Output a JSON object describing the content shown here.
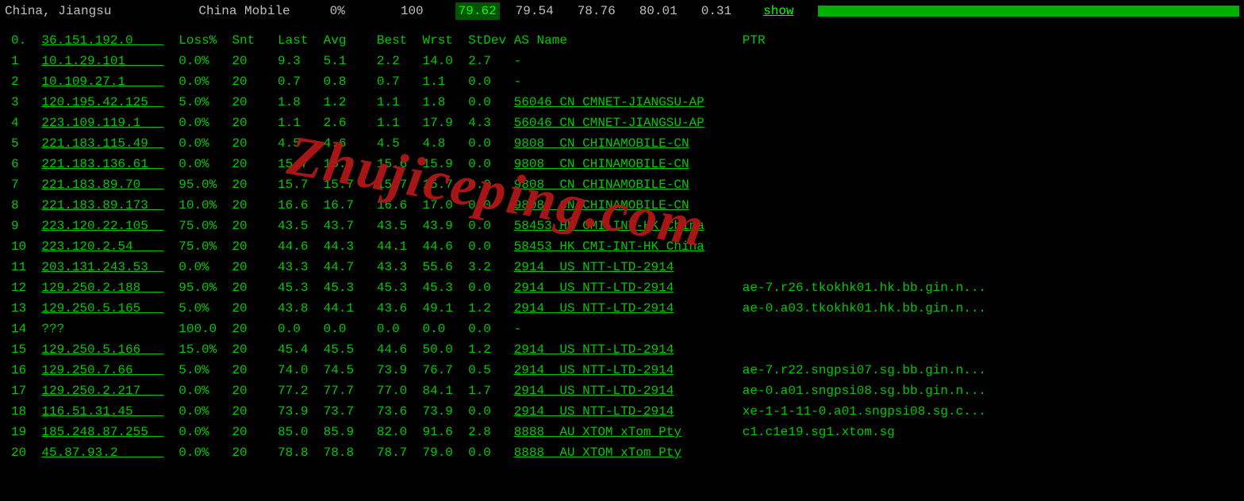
{
  "topbar": {
    "location": "China, Jiangsu",
    "isp": "China Mobile",
    "loss": "0%",
    "snt": "100",
    "v1": "79.62",
    "v2": "79.54",
    "v3": "78.76",
    "v4": "80.01",
    "v5": "0.31",
    "show": "show"
  },
  "headers": {
    "hop": "0.",
    "ip": "36.151.192.0",
    "loss": "Loss%",
    "snt": "Snt",
    "last": "Last",
    "avg": "Avg",
    "best": "Best",
    "wrst": "Wrst",
    "stdev": "StDev",
    "asname": "AS Name",
    "ptr": "PTR"
  },
  "rows": [
    {
      "n": "1",
      "ip": "10.1.29.101",
      "loss": "0.0%",
      "snt": "20",
      "last": "9.3",
      "avg": "5.1",
      "best": "2.2",
      "wrst": "14.0",
      "stdev": "2.7",
      "as": "-",
      "ptr": ""
    },
    {
      "n": "2",
      "ip": "10.109.27.1",
      "loss": "0.0%",
      "snt": "20",
      "last": "0.7",
      "avg": "0.8",
      "best": "0.7",
      "wrst": "1.1",
      "stdev": "0.0",
      "as": "-",
      "ptr": ""
    },
    {
      "n": "3",
      "ip": "120.195.42.125",
      "loss": "5.0%",
      "snt": "20",
      "last": "1.8",
      "avg": "1.2",
      "best": "1.1",
      "wrst": "1.8",
      "stdev": "0.0",
      "as": "56046 CN CMNET-JIANGSU-AP",
      "ptr": ""
    },
    {
      "n": "4",
      "ip": "223.109.119.1",
      "loss": "0.0%",
      "snt": "20",
      "last": "1.1",
      "avg": "2.6",
      "best": "1.1",
      "wrst": "17.9",
      "stdev": "4.3",
      "as": "56046 CN CMNET-JIANGSU-AP",
      "ptr": ""
    },
    {
      "n": "5",
      "ip": "221.183.115.49",
      "loss": "0.0%",
      "snt": "20",
      "last": "4.5",
      "avg": "4.6",
      "best": "4.5",
      "wrst": "4.8",
      "stdev": "0.0",
      "as": "9808  CN CHINAMOBILE-CN",
      "ptr": ""
    },
    {
      "n": "6",
      "ip": "221.183.136.61",
      "loss": "0.0%",
      "snt": "20",
      "last": "15.7",
      "avg": "15.7",
      "best": "15.6",
      "wrst": "15.9",
      "stdev": "0.0",
      "as": "9808  CN CHINAMOBILE-CN",
      "ptr": ""
    },
    {
      "n": "7",
      "ip": "221.183.89.70",
      "loss": "95.0%",
      "snt": "20",
      "last": "15.7",
      "avg": "15.7",
      "best": "15.7",
      "wrst": "15.7",
      "stdev": "0.0",
      "as": "9808  CN CHINAMOBILE-CN",
      "ptr": ""
    },
    {
      "n": "8",
      "ip": "221.183.89.173",
      "loss": "10.0%",
      "snt": "20",
      "last": "16.6",
      "avg": "16.7",
      "best": "16.6",
      "wrst": "17.0",
      "stdev": "0.0",
      "as": "9808  CN CHINAMOBILE-CN",
      "ptr": ""
    },
    {
      "n": "9",
      "ip": "223.120.22.105",
      "loss": "75.0%",
      "snt": "20",
      "last": "43.5",
      "avg": "43.7",
      "best": "43.5",
      "wrst": "43.9",
      "stdev": "0.0",
      "as": "58453 HK CMI-INT-HK China",
      "ptr": ""
    },
    {
      "n": "10",
      "ip": "223.120.2.54",
      "loss": "75.0%",
      "snt": "20",
      "last": "44.6",
      "avg": "44.3",
      "best": "44.1",
      "wrst": "44.6",
      "stdev": "0.0",
      "as": "58453 HK CMI-INT-HK China",
      "ptr": ""
    },
    {
      "n": "11",
      "ip": "203.131.243.53",
      "loss": "0.0%",
      "snt": "20",
      "last": "43.3",
      "avg": "44.7",
      "best": "43.3",
      "wrst": "55.6",
      "stdev": "3.2",
      "as": "2914  US NTT-LTD-2914",
      "ptr": ""
    },
    {
      "n": "12",
      "ip": "129.250.2.188",
      "loss": "95.0%",
      "snt": "20",
      "last": "45.3",
      "avg": "45.3",
      "best": "45.3",
      "wrst": "45.3",
      "stdev": "0.0",
      "as": "2914  US NTT-LTD-2914",
      "ptr": "ae-7.r26.tkokhk01.hk.bb.gin.n..."
    },
    {
      "n": "13",
      "ip": "129.250.5.165",
      "loss": "5.0%",
      "snt": "20",
      "last": "43.8",
      "avg": "44.1",
      "best": "43.6",
      "wrst": "49.1",
      "stdev": "1.2",
      "as": "2914  US NTT-LTD-2914",
      "ptr": "ae-0.a03.tkokhk01.hk.bb.gin.n..."
    },
    {
      "n": "14",
      "ip": "???",
      "loss": "100.0",
      "snt": "20",
      "last": "0.0",
      "avg": "0.0",
      "best": "0.0",
      "wrst": "0.0",
      "stdev": "0.0",
      "as": "-",
      "ptr": ""
    },
    {
      "n": "15",
      "ip": "129.250.5.166",
      "loss": "15.0%",
      "snt": "20",
      "last": "45.4",
      "avg": "45.5",
      "best": "44.6",
      "wrst": "50.0",
      "stdev": "1.2",
      "as": "2914  US NTT-LTD-2914",
      "ptr": ""
    },
    {
      "n": "16",
      "ip": "129.250.7.66",
      "loss": "5.0%",
      "snt": "20",
      "last": "74.0",
      "avg": "74.5",
      "best": "73.9",
      "wrst": "76.7",
      "stdev": "0.5",
      "as": "2914  US NTT-LTD-2914",
      "ptr": "ae-7.r22.sngpsi07.sg.bb.gin.n..."
    },
    {
      "n": "17",
      "ip": "129.250.2.217",
      "loss": "0.0%",
      "snt": "20",
      "last": "77.2",
      "avg": "77.7",
      "best": "77.0",
      "wrst": "84.1",
      "stdev": "1.7",
      "as": "2914  US NTT-LTD-2914",
      "ptr": "ae-0.a01.sngpsi08.sg.bb.gin.n..."
    },
    {
      "n": "18",
      "ip": "116.51.31.45",
      "loss": "0.0%",
      "snt": "20",
      "last": "73.9",
      "avg": "73.7",
      "best": "73.6",
      "wrst": "73.9",
      "stdev": "0.0",
      "as": "2914  US NTT-LTD-2914",
      "ptr": "xe-1-1-11-0.a01.sngpsi08.sg.c..."
    },
    {
      "n": "19",
      "ip": "185.248.87.255",
      "loss": "0.0%",
      "snt": "20",
      "last": "85.0",
      "avg": "85.9",
      "best": "82.0",
      "wrst": "91.6",
      "stdev": "2.8",
      "as": "8888  AU XTOM xTom Pty",
      "ptr": "c1.c1e19.sg1.xtom.sg"
    },
    {
      "n": "20",
      "ip": "45.87.93.2",
      "loss": "0.0%",
      "snt": "20",
      "last": "78.8",
      "avg": "78.8",
      "best": "78.7",
      "wrst": "79.0",
      "stdev": "0.0",
      "as": "8888  AU XTOM xTom Pty",
      "ptr": ""
    }
  ],
  "watermark": "Zhujiceping.com"
}
